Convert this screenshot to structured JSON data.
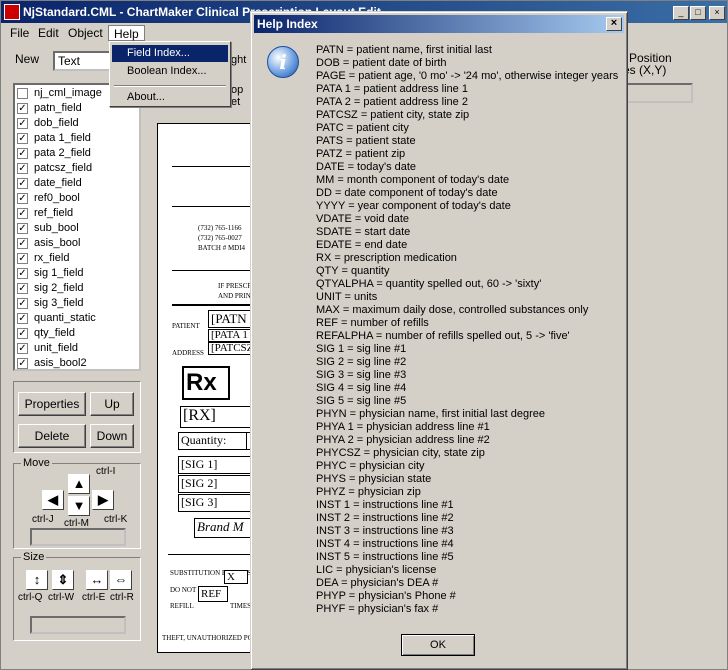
{
  "main_window": {
    "title": "NjStandard.CML - ChartMaker Clinical Prescription Layout Edit"
  },
  "menu": [
    "File",
    "Edit",
    "Object",
    "Help"
  ],
  "help_menu": {
    "field_index": "Field Index...",
    "boolean_index": "Boolean Index...",
    "about": "About..."
  },
  "toolbar": {
    "new_label": "New",
    "new_value": "Text"
  },
  "behind_text": {
    "ght": "ght",
    "op": "op",
    "et": "et",
    "position": "Position",
    "xy": "es (X,Y)"
  },
  "fields": [
    {
      "name": "nj_cml_image",
      "checked": false
    },
    {
      "name": "patn_field",
      "checked": true
    },
    {
      "name": "dob_field",
      "checked": true
    },
    {
      "name": "pata 1_field",
      "checked": true
    },
    {
      "name": "pata 2_field",
      "checked": true
    },
    {
      "name": "patcsz_field",
      "checked": true
    },
    {
      "name": "date_field",
      "checked": true
    },
    {
      "name": "ref0_bool",
      "checked": true
    },
    {
      "name": "ref_field",
      "checked": true
    },
    {
      "name": "sub_bool",
      "checked": true
    },
    {
      "name": "asis_bool",
      "checked": true
    },
    {
      "name": "rx_field",
      "checked": true
    },
    {
      "name": "sig 1_field",
      "checked": true
    },
    {
      "name": "sig 2_field",
      "checked": true
    },
    {
      "name": "sig 3_field",
      "checked": true
    },
    {
      "name": "quanti_static",
      "checked": true
    },
    {
      "name": "qty_field",
      "checked": true
    },
    {
      "name": "unit_field",
      "checked": true
    },
    {
      "name": "asis_bool2",
      "checked": true
    }
  ],
  "buttons": {
    "properties": "Properties",
    "up": "Up",
    "delete": "Delete",
    "down": "Down"
  },
  "move": {
    "legend": "Move",
    "ctrl_i": "ctrl-I",
    "ctrl_j": "ctrl-J",
    "ctrl_m": "ctrl-M",
    "ctrl_k": "ctrl-K"
  },
  "size": {
    "legend": "Size",
    "ctrl_q": "ctrl-Q",
    "ctrl_w": "ctrl-W",
    "ctrl_e": "ctrl-E",
    "ctrl_r": "ctrl-R"
  },
  "doc": {
    "phone1": "(732) 765-1166",
    "phone2": "(732) 765-0027",
    "batch": "BATCH # MDI4",
    "if_presc": "IF PRESCR",
    "and_prin": "AND PRIN",
    "patient": "PATIENT",
    "address": "ADDRESS",
    "patn": "[PATN",
    "pata1": "[PATA 1",
    "patcsz": "[PATCSZ",
    "rx": "Rx",
    "rx_field": "[RX]",
    "quantity": "Quantity:",
    "sig1": "[SIG 1]",
    "sig2": "[SIG 2]",
    "sig3": "[SIG 3]",
    "brand": "Brand M",
    "substitution": "SUBSTITUTION PERMISS",
    "do_not": "DO NOT REFILL",
    "refill": "REFILL",
    "times": "TIMES",
    "x": "X",
    "ref": "REF",
    "footer": "THEFT, UNAUTHORIZED POSSESSI"
  },
  "help_dialog": {
    "title": "Help Index",
    "ok": "OK",
    "lines": [
      "PATN = patient name, first initial last",
      "DOB = patient date of birth",
      "PAGE = patient age, '0 mo' -> '24 mo', otherwise integer years",
      "PATA 1 = patient address line 1",
      "PATA 2 = patient address line 2",
      "PATCSZ = patient city, state zip",
      "PATC = patient city",
      "PATS = patient state",
      "PATZ = patient zip",
      "DATE = today's date",
      "MM = month component of today's date",
      "DD = date component of today's date",
      "YYYY = year component of today's date",
      "VDATE = void date",
      "SDATE = start date",
      "EDATE = end date",
      "RX = prescription medication",
      "QTY = quantity",
      "QTYALPHA = quantity spelled out, 60 -> 'sixty'",
      "UNIT = units",
      "MAX = maximum daily dose, controlled substances only",
      "REF = number of refills",
      "REFALPHA = number of refills spelled out, 5 -> 'five'",
      "SIG 1 = sig line #1",
      "SIG 2 = sig line #2",
      "SIG 3 = sig line #3",
      "SIG 4 = sig line #4",
      "SIG 5 = sig line #5",
      "PHYN = physician name, first initial last degree",
      "PHYA 1 = physician address line #1",
      "PHYA 2 = physician address line #2",
      "PHYCSZ = physician city, state zip",
      "PHYC = physician city",
      "PHYS = physician state",
      "PHYZ = physician zip",
      "INST 1 = instructions line #1",
      "INST 2 = instructions line #2",
      "INST 3 = instructions line #3",
      "INST 4 = instructions line #4",
      "INST 5 = instructions line #5",
      "LIC = physician's license",
      "DEA = physician's DEA #",
      "PHYP = physician's Phone #",
      "PHYF = physician's fax #"
    ]
  }
}
